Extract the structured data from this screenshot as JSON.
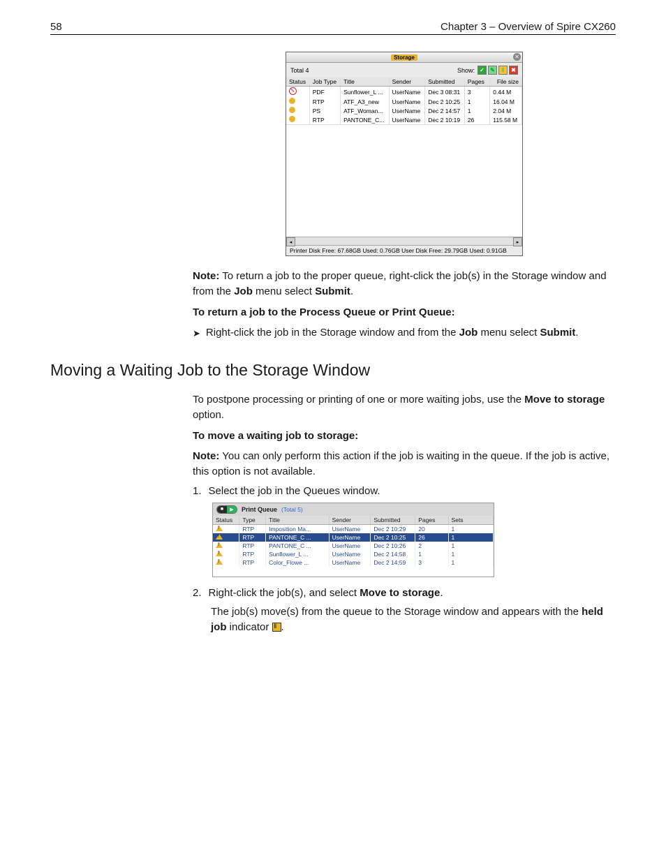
{
  "header": {
    "page_number": "58",
    "chapter": "Chapter 3 – Overview of Spire CX260"
  },
  "storage_window": {
    "title": "Storage",
    "total_label": "Total 4",
    "show_label": "Show:",
    "columns": {
      "status": "Status",
      "job_type": "Job Type",
      "title": "Title",
      "sender": "Sender",
      "submitted": "Submitted",
      "pages": "Pages",
      "file_size": "File size"
    },
    "rows": [
      {
        "status": "abort",
        "job_type": "PDF",
        "title": "Sunflower_L ...",
        "sender": "UserName",
        "submitted": "Dec 3 08:31",
        "pages": "3",
        "file_size": "0.44 M"
      },
      {
        "status": "hold",
        "job_type": "RTP",
        "title": "ATF_A3_new",
        "sender": "UserName",
        "submitted": "Dec 2 10:25",
        "pages": "1",
        "file_size": "16.04 M"
      },
      {
        "status": "hold",
        "job_type": "PS",
        "title": "ATF_Woman...",
        "sender": "UserName",
        "submitted": "Dec 2 14:57",
        "pages": "1",
        "file_size": "2.04 M"
      },
      {
        "status": "hold",
        "job_type": "RTP",
        "title": "PANTONE_C...",
        "sender": "UserName",
        "submitted": "Dec 2 10:19",
        "pages": "26",
        "file_size": "115.58 M"
      }
    ],
    "status_bar": "Printer Disk Free: 67.68GB Used: 0.76GB   User Disk Free: 29.79GB Used: 0.91GB"
  },
  "body": {
    "note1_label": "Note:",
    "note1_a": "  To return a job to the proper queue, right-click the job(s) in the Storage window and from the ",
    "note1_b": "Job",
    "note1_c": " menu select ",
    "note1_d": "Submit",
    "note1_e": ".",
    "proc_heading": "To return a job to the Process Queue or Print Queue:",
    "bullet1_a": "Right-click the job in the Storage window and from the ",
    "bullet1_b": "Job",
    "bullet1_c": " menu select ",
    "bullet1_d": "Submit",
    "bullet1_e": ".",
    "section_heading": "Moving a Waiting Job to the Storage Window",
    "intro_a": "To postpone processing or printing of one or more waiting jobs, use the ",
    "intro_b": "Move to storage",
    "intro_c": " option.",
    "move_heading": "To move a waiting job to storage:",
    "note2_label": "Note:",
    "note2_text": "  You can only perform this action if the job is waiting in the queue. If the job is active, this option is not available.",
    "step1_num": "1.",
    "step1_text": "Select the job in the Queues window.",
    "step2_num": "2.",
    "step2_a": "Right-click the job(s), and select ",
    "step2_b": "Move to storage",
    "step2_c": ".",
    "result_a": "The job(s) move(s) from the queue to the Storage window and appears with the ",
    "result_b": "held job",
    "result_c": " indicator ",
    "result_d": "."
  },
  "queue_window": {
    "title": "Print Queue",
    "count": "(Total 5)",
    "columns": {
      "status": "Status",
      "type": "Type",
      "title": "Title",
      "sender": "Sender",
      "submitted": "Submitted",
      "pages": "Pages",
      "sets": "Sets"
    },
    "rows": [
      {
        "selected": false,
        "type": "RTP",
        "title": "Imposition Ma...",
        "sender": "UserName",
        "submitted": "Dec 2 10:29",
        "pages": "20",
        "sets": "1"
      },
      {
        "selected": true,
        "type": "RTP",
        "title": "PANTONE_C ...",
        "sender": "UserName",
        "submitted": "Dec 2 10:25",
        "pages": "26",
        "sets": "1"
      },
      {
        "selected": false,
        "type": "RTP",
        "title": "PANTONE_C ...",
        "sender": "UserName",
        "submitted": "Dec 2 10:26",
        "pages": "2",
        "sets": "1"
      },
      {
        "selected": false,
        "type": "RTP",
        "title": "Sunflower_L ...",
        "sender": "UserName",
        "submitted": "Dec 2 14:58",
        "pages": "1",
        "sets": "1"
      },
      {
        "selected": false,
        "type": "RTP",
        "title": "Color_Flowe ...",
        "sender": "UserName",
        "submitted": "Dec 2 14:59",
        "pages": "3",
        "sets": "1"
      }
    ]
  }
}
